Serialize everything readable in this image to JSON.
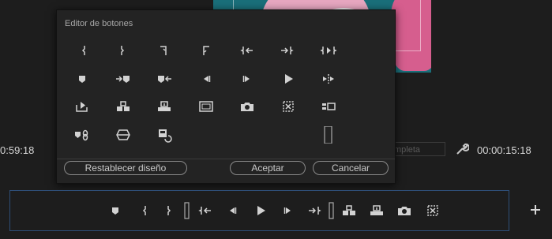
{
  "dialog": {
    "title": "Editor de botones",
    "reset_label": "Restablecer diseño",
    "ok_label": "Aceptar",
    "cancel_label": "Cancelar"
  },
  "timecodes": {
    "left": "0:59:18",
    "right": "00:00:15:18"
  },
  "zoom_select": {
    "value": "mpleta"
  },
  "icon_grid": [
    "mark-in-icon",
    "mark-out-icon",
    "mark-clip-in-icon",
    "mark-clip-out-icon",
    "go-to-in-icon",
    "go-to-out-icon",
    "play-in-to-out-icon",
    "add-marker-icon",
    "go-to-next-marker-icon",
    "go-to-previous-marker-icon",
    "step-back-icon",
    "step-forward-icon",
    "play-stop-icon",
    "shuttle-icon",
    "loop-playback-icon",
    "insert-icon",
    "overwrite-icon",
    "safe-margins-icon",
    "export-frame-icon",
    "multi-camera-icon",
    "vr-video-icon",
    "clear-marker-icon",
    "comparison-view-icon",
    "toggle-proxies-icon",
    "spacer-icon"
  ],
  "toolbar_icons": [
    "add-marker-icon",
    "mark-in-icon",
    "mark-out-icon",
    "spacer-icon",
    "go-to-in-icon",
    "step-back-icon",
    "play-stop-icon",
    "step-forward-icon",
    "go-to-out-icon",
    "spacer-icon",
    "insert-icon",
    "overwrite-icon",
    "export-frame-icon",
    "multi-camera-icon"
  ],
  "colors": {
    "background": "#1d1d1d",
    "dialog": "#232323",
    "accent_border": "#2e4f78",
    "icon": "#d2d2d2"
  }
}
